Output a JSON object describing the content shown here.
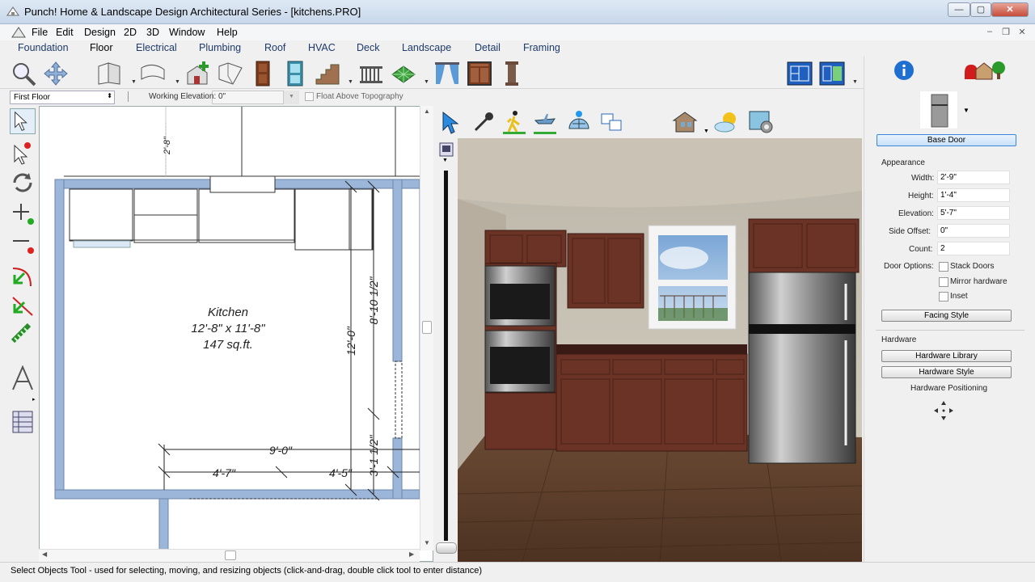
{
  "window": {
    "title": "Punch! Home & Landscape Design Architectural Series - [kitchens.PRO]",
    "minimize": "—",
    "maximize": "▢",
    "close": "✕"
  },
  "menu": {
    "items": [
      "File",
      "Edit",
      "Design",
      "2D",
      "3D",
      "Window",
      "Help"
    ],
    "mdi_min": "–",
    "mdi_restore": "❐",
    "mdi_close": "✕"
  },
  "tabs": [
    "Foundation",
    "Floor",
    "Electrical",
    "Plumbing",
    "Roof",
    "HVAC",
    "Deck",
    "Landscape",
    "Detail",
    "Framing"
  ],
  "active_tab": "Floor",
  "options": {
    "floor_value": "First Floor",
    "working_elevation_label": "Working Elevation: 0\"",
    "float_topography_label": "Float Above Topography"
  },
  "plan": {
    "room_name": "Kitchen",
    "room_size": "12'-8\" x 11'-8\"",
    "room_area": "147 sq.ft.",
    "dim_top": "2'-8\"",
    "dim_right_upper": "8'-10 1/2\"",
    "dim_right_mid": "12'-0\"",
    "dim_right_lower": "3'-1 1/2\"",
    "dim_bottom_total": "9'-0\"",
    "dim_bottom_left": "4'-7\"",
    "dim_bottom_right": "4'-5\""
  },
  "right_panel": {
    "object_name": "Base Door",
    "appearance_heading": "Appearance",
    "fields": [
      {
        "label": "Width:",
        "value": "2'-9\""
      },
      {
        "label": "Height:",
        "value": "1'-4\""
      },
      {
        "label": "Elevation:",
        "value": "5'-7\""
      },
      {
        "label": "Side Offset:",
        "value": "0\""
      },
      {
        "label": "Count:",
        "value": "2"
      }
    ],
    "door_options_label": "Door Options:",
    "door_options": [
      "Stack Doors",
      "Mirror hardware",
      "Inset"
    ],
    "facing_style_button": "Facing Style",
    "hardware_heading": "Hardware",
    "hardware_library_button": "Hardware Library",
    "hardware_style_button": "Hardware Style",
    "hardware_positioning_label": "Hardware Positioning"
  },
  "status": {
    "text": "Select Objects Tool - used for selecting, moving, and resizing objects (click-and-drag, double click tool to enter distance)"
  },
  "colors": {
    "wall_blue": "#9cb6d9",
    "title_bar": "#c7d7ea",
    "accent_blue": "#1f6fd1",
    "cabinet_wood": "#6b3326",
    "floor_wood": "#5b3d2a"
  }
}
